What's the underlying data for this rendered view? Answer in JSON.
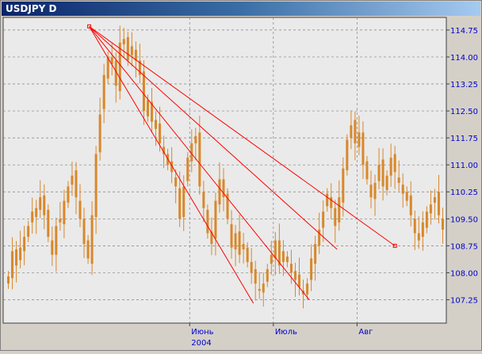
{
  "window": {
    "title": "USDJPY D"
  },
  "colors": {
    "plot_bg": "#eaeaea",
    "grid": "#808080",
    "candle": "#d8882a",
    "trendline": "#ff0000",
    "price_label": "#0000cc",
    "date_label": "#0000cc"
  },
  "chart_data": {
    "type": "candlestick",
    "symbol": "USDJPY",
    "timeframe": "D",
    "y_ticks": [
      "114.75",
      "114.00",
      "113.25",
      "112.50",
      "111.75",
      "111.00",
      "110.25",
      "109.50",
      "108.75",
      "108.00",
      "107.25"
    ],
    "ylim": [
      106.6,
      115.1
    ],
    "x_labels": [
      "Июнь",
      "Июль",
      "Авг"
    ],
    "x_year_label": "2004",
    "x_label_positions": [
      45.5,
      66.5,
      87.5
    ],
    "n_bars": 110,
    "grid": true,
    "closes": [
      107.9,
      108.6,
      108.2,
      108.7,
      109.0,
      109.3,
      109.7,
      109.8,
      110.1,
      109.6,
      109.0,
      108.5,
      109.3,
      109.5,
      110.0,
      110.4,
      110.7,
      110.1,
      109.5,
      108.8,
      108.4,
      109.6,
      111.3,
      112.4,
      113.5,
      114.0,
      113.8,
      113.2,
      114.4,
      114.5,
      113.9,
      114.3,
      113.9,
      113.5,
      112.5,
      112.8,
      112.2,
      112.0,
      111.6,
      111.3,
      111.0,
      110.8,
      110.4,
      109.5,
      110.4,
      111.2,
      111.6,
      111.8,
      110.4,
      109.8,
      109.1,
      108.8,
      110.0,
      110.6,
      110.1,
      109.5,
      108.7,
      109.1,
      108.5,
      108.8,
      108.3,
      108.0,
      107.7,
      107.5,
      107.7,
      108.1,
      108.5,
      108.9,
      108.2,
      108.6,
      108.3,
      108.0,
      107.8,
      107.6,
      107.4,
      107.7,
      108.4,
      108.8,
      109.2,
      109.7,
      110.2,
      109.8,
      109.3,
      110.1,
      110.9,
      111.7,
      112.1,
      111.6,
      111.9,
      111.0,
      110.6,
      110.1,
      110.5,
      111.0,
      110.4,
      110.7,
      111.2,
      110.8,
      110.5,
      110.2,
      110.0,
      109.6,
      109.1,
      108.9,
      109.4,
      109.7,
      109.9,
      110.1,
      109.6,
      109.2
    ],
    "trendlines": [
      {
        "from": {
          "bar": 20.3,
          "price": 114.85
        },
        "to": {
          "bar": 61.5,
          "price": 107.15
        }
      },
      {
        "from": {
          "bar": 20.3,
          "price": 114.85
        },
        "to": {
          "bar": 75.5,
          "price": 107.25
        }
      },
      {
        "from": {
          "bar": 20.3,
          "price": 114.85
        },
        "to": {
          "bar": 82.5,
          "price": 108.65
        }
      },
      {
        "from": {
          "bar": 20.3,
          "price": 114.85
        },
        "to": {
          "bar": 97.0,
          "price": 108.75
        }
      }
    ],
    "markers": [
      {
        "bar": 20.3,
        "price": 114.85
      },
      {
        "bar": 97.0,
        "price": 108.75
      }
    ]
  }
}
